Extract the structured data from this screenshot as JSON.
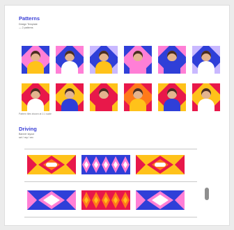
{
  "patterns": {
    "title": "Patterns",
    "meta_lines": [
      "Design Template",
      "— 2 patterns"
    ],
    "caption": "Pattern tiles shown at 1:1 scale"
  },
  "driving": {
    "title": "Driving",
    "meta_lines": [
      "Banner layout",
      "set / rep / rev"
    ]
  },
  "colors": {
    "blue": "#2f3fd8",
    "pink": "#ff7fd6",
    "red": "#e8184a",
    "yellow": "#ffc21a",
    "orange": "#ff7a1a",
    "lilac": "#c9b8ff",
    "skin": "#e4b48e",
    "hair": "#4a2e22"
  },
  "tiles_row1": [
    {
      "bg": "#2f3fd8",
      "diamond": "#ff7fd6",
      "shirt": "#ffc21a"
    },
    {
      "bg": "#ff7fd6",
      "diamond": "#2f3fd8",
      "shirt": "#ffffff"
    },
    {
      "bg": "#c9b8ff",
      "diamond": "#2f3fd8",
      "shirt": "#ffc21a"
    },
    {
      "bg": "#2f3fd8",
      "diamond": "#ff7fd6",
      "shirt": "#ff7fd6"
    },
    {
      "bg": "#ff7fd6",
      "diamond": "#2f3fd8",
      "shirt": "#2f3fd8"
    },
    {
      "bg": "#c9b8ff",
      "diamond": "#2f3fd8",
      "shirt": "#ffffff"
    }
  ],
  "tiles_row2": [
    {
      "bg": "#ffc21a",
      "diamond": "#e8184a",
      "shirt": "#ffffff"
    },
    {
      "bg": "#e8184a",
      "diamond": "#ffc21a",
      "shirt": "#2f3fd8"
    },
    {
      "bg": "#ffc21a",
      "diamond": "#e8184a",
      "shirt": "#e8184a"
    },
    {
      "bg": "#e8184a",
      "diamond": "#ff7a1a",
      "shirt": "#ffc21a"
    },
    {
      "bg": "#ffc21a",
      "diamond": "#e8184a",
      "shirt": "#2f3fd8"
    },
    {
      "bg": "#e8184a",
      "diamond": "#ffc21a",
      "shirt": "#ffffff"
    }
  ],
  "banners": [
    {
      "style": "ribbon",
      "palette": [
        "#ffc21a",
        "#e8184a",
        "#ff7a1a"
      ]
    },
    {
      "style": "star",
      "palette": [
        "#2f3fd8",
        "#ffffff",
        "#ff7fd6"
      ]
    },
    {
      "style": "ribbon",
      "palette": [
        "#ffc21a",
        "#e8184a",
        "#ff7a1a"
      ]
    },
    {
      "style": "ribbon",
      "palette": [
        "#2f3fd8",
        "#ff7fd6",
        "#ffffff"
      ]
    },
    {
      "style": "star",
      "palette": [
        "#e8184a",
        "#ffc21a",
        "#ff7a1a"
      ]
    },
    {
      "style": "ribbon",
      "palette": [
        "#2f3fd8",
        "#ff7fd6",
        "#ffffff"
      ]
    }
  ]
}
